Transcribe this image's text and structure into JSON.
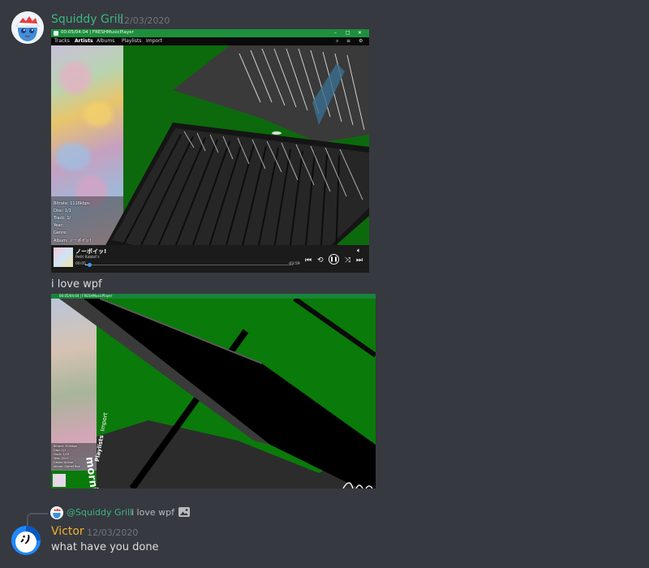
{
  "messages": [
    {
      "author": "Squiddy Grill",
      "timestamp": "12/03/2020",
      "author_color": "#3bb580",
      "avatar_icon": "squid-girl-avatar",
      "attachment_1": {
        "window_title": "00:05/04:04 | FRESHMusicPlayer",
        "menu": [
          "Tracks",
          "Artists",
          "Albums",
          "Playlists",
          "Import"
        ],
        "selected_menu": "Artists",
        "metadata_lines": [
          "Bitrate: 1116kbps",
          "Disc: 1/1",
          "Track: 1/",
          "Year:",
          "Genre:",
          "Album: ノーポイッ!"
        ],
        "now_playing_title": "ノーポイッ!",
        "now_playing_artist": "Petit Rabbit's",
        "elapsed": "00:05",
        "remaining": "-03:59",
        "progress": 0.02
      },
      "text": "i love wpf",
      "attachment_2": {
        "window_title": "00:05/04:04 | FRESHMusicPlayer",
        "overlay_text": [
          "Playlists",
          "Import",
          "morning"
        ],
        "metadata_lines": [
          "Bitrate: 320kbps",
          "Disc: 1/1",
          "Track: 1/19",
          "Year: 2017",
          "Genre: Anime",
          "Album: Comet Box"
        ]
      }
    },
    {
      "reply_to_author": "@Squiddy Grill",
      "reply_to_text": "i love wpf",
      "author": "Victor",
      "author_color": "#f0b132",
      "timestamp": "12/03/2020",
      "avatar_text": ";)",
      "text": "what have you done"
    }
  ]
}
